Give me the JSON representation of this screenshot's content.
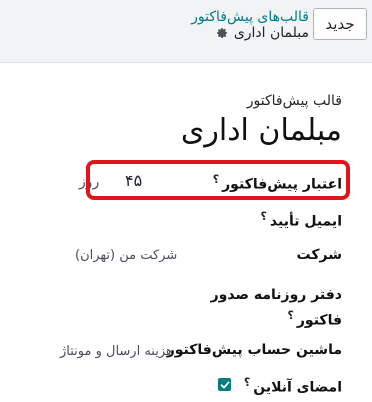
{
  "toolbar": {
    "new_label": "جدید"
  },
  "breadcrumb": {
    "parent": "قالب‌های پیش‌فاکتور",
    "record": "مبلمان اداری"
  },
  "icons": {
    "settings": "gear-icon",
    "check": "check-icon"
  },
  "form": {
    "subtitle": "قالب پیش‌فاکتور",
    "title": "مبلمان اداری",
    "validity": {
      "label": "اعتبار پیش‌فاکتور",
      "help": "؟",
      "value": "۴۵",
      "unit": "روز"
    },
    "confirmation_email": {
      "label": "ایمیل تأیید",
      "help": "؟"
    },
    "company": {
      "label": "شرکت",
      "value": "شرکت من (تهران)"
    },
    "journal": {
      "label_line1": "دفتر روزنامه صدور",
      "label_line2": "فاکتور",
      "help": "؟"
    },
    "quotation_lines": {
      "label": "ماشین حساب پیش‌فاکتور",
      "value": "هزینه ارسال و مونتاژ"
    },
    "online_signature": {
      "label": "امضای آنلاین",
      "help": "؟",
      "checked": true
    }
  },
  "colors": {
    "accent": "#017e84",
    "highlight_border": "#e1141b"
  }
}
